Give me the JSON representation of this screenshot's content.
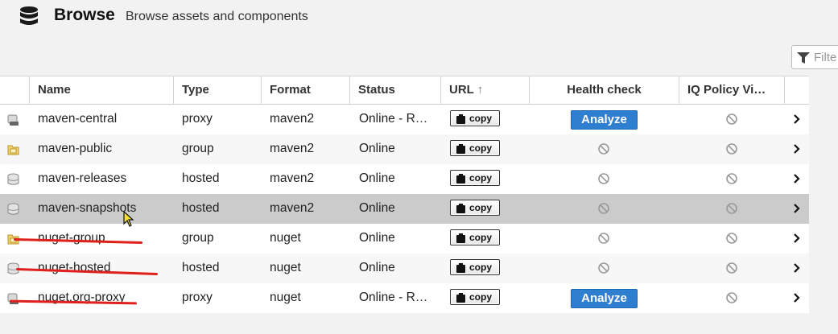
{
  "header": {
    "title": "Browse",
    "subtitle": "Browse assets and components",
    "icon": "database-icon"
  },
  "filter": {
    "placeholder": "Filte"
  },
  "columns": {
    "name": "Name",
    "type": "Type",
    "format": "Format",
    "status": "Status",
    "url": "URL",
    "url_sort": "↑",
    "health": "Health check",
    "iq": "IQ Policy Vi…"
  },
  "copy_label": "copy",
  "analyze_label": "Analyze",
  "rows": [
    {
      "name": "maven-central",
      "type": "proxy",
      "format": "maven2",
      "status": "Online - R…",
      "health": "analyze"
    },
    {
      "name": "maven-public",
      "type": "group",
      "format": "maven2",
      "status": "Online",
      "health": "na"
    },
    {
      "name": "maven-releases",
      "type": "hosted",
      "format": "maven2",
      "status": "Online",
      "health": "na"
    },
    {
      "name": "maven-snapshots",
      "type": "hosted",
      "format": "maven2",
      "status": "Online",
      "health": "na",
      "selected": true
    },
    {
      "name": "nuget-group",
      "type": "group",
      "format": "nuget",
      "status": "Online",
      "health": "na"
    },
    {
      "name": "nuget-hosted",
      "type": "hosted",
      "format": "nuget",
      "status": "Online",
      "health": "na"
    },
    {
      "name": "nuget.org-proxy",
      "type": "proxy",
      "format": "nuget",
      "status": "Online - R…",
      "health": "analyze"
    }
  ],
  "colors": {
    "analyze": "#2f7fd1",
    "selected_row": "#cbcbcb",
    "annotation": "#e0201c"
  }
}
